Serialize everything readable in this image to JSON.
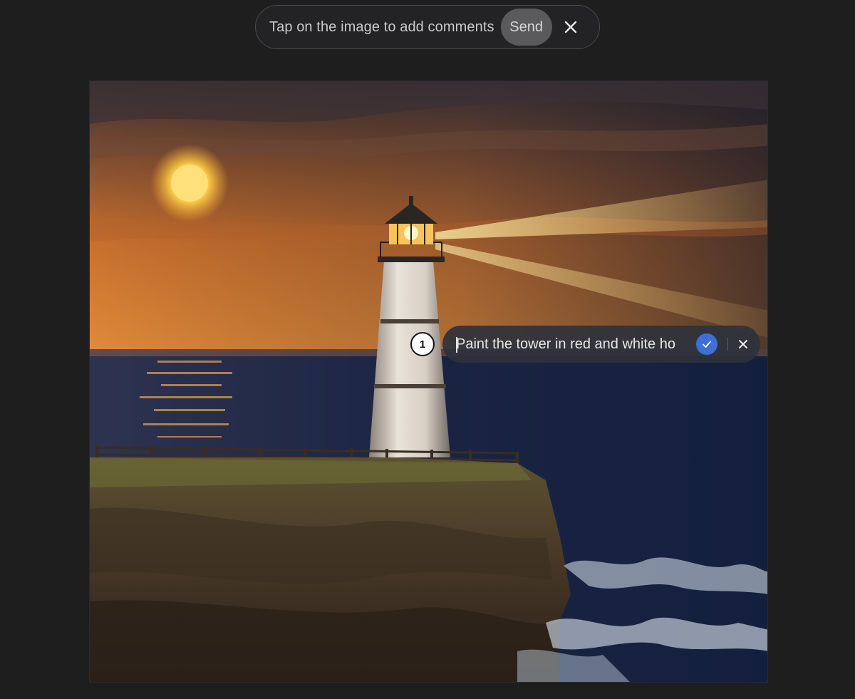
{
  "toolbar": {
    "hint": "Tap on the image to add comments",
    "send_label": "Send",
    "close_icon": "close-icon"
  },
  "annotation": {
    "number": "1",
    "comment_text": "Paint the tower in red and white ho",
    "confirm_icon": "check-icon",
    "dismiss_icon": "close-icon"
  },
  "colors": {
    "background": "#1e1e1f",
    "accent": "#3d6fd6"
  }
}
